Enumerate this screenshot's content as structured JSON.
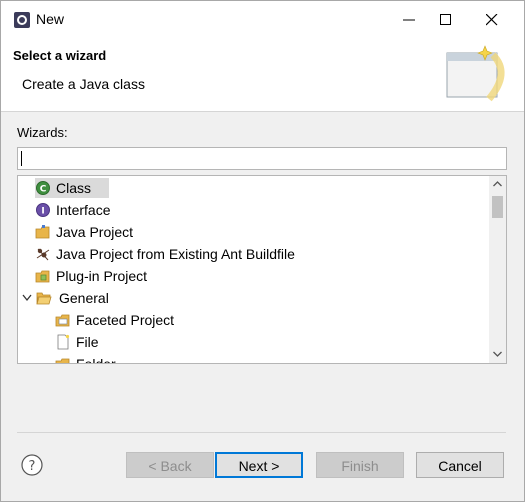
{
  "window": {
    "title": "New"
  },
  "header": {
    "title": "Select a wizard",
    "description": "Create a Java class"
  },
  "wizards": {
    "label": "Wizards:",
    "filter_value": ""
  },
  "tree": {
    "items": [
      {
        "label": "Class",
        "icon": "java-class-icon",
        "selected": true
      },
      {
        "label": "Interface",
        "icon": "java-interface-icon"
      },
      {
        "label": "Java Project",
        "icon": "java-project-icon"
      },
      {
        "label": "Java Project from Existing Ant Buildfile",
        "icon": "ant-buildfile-icon"
      },
      {
        "label": "Plug-in Project",
        "icon": "plugin-project-icon"
      },
      {
        "label": "General",
        "icon": "folder-open-icon",
        "expanded": true
      },
      {
        "label": "Faceted Project",
        "icon": "faceted-project-icon"
      },
      {
        "label": "File",
        "icon": "file-icon"
      },
      {
        "label": "Folder",
        "icon": "folder-icon"
      }
    ]
  },
  "buttons": {
    "back": "< Back",
    "next": "Next >",
    "finish": "Finish",
    "cancel": "Cancel"
  },
  "colors": {
    "selection": "#dadada",
    "default_border": "#0078d7",
    "folder": "#e8b54a"
  }
}
